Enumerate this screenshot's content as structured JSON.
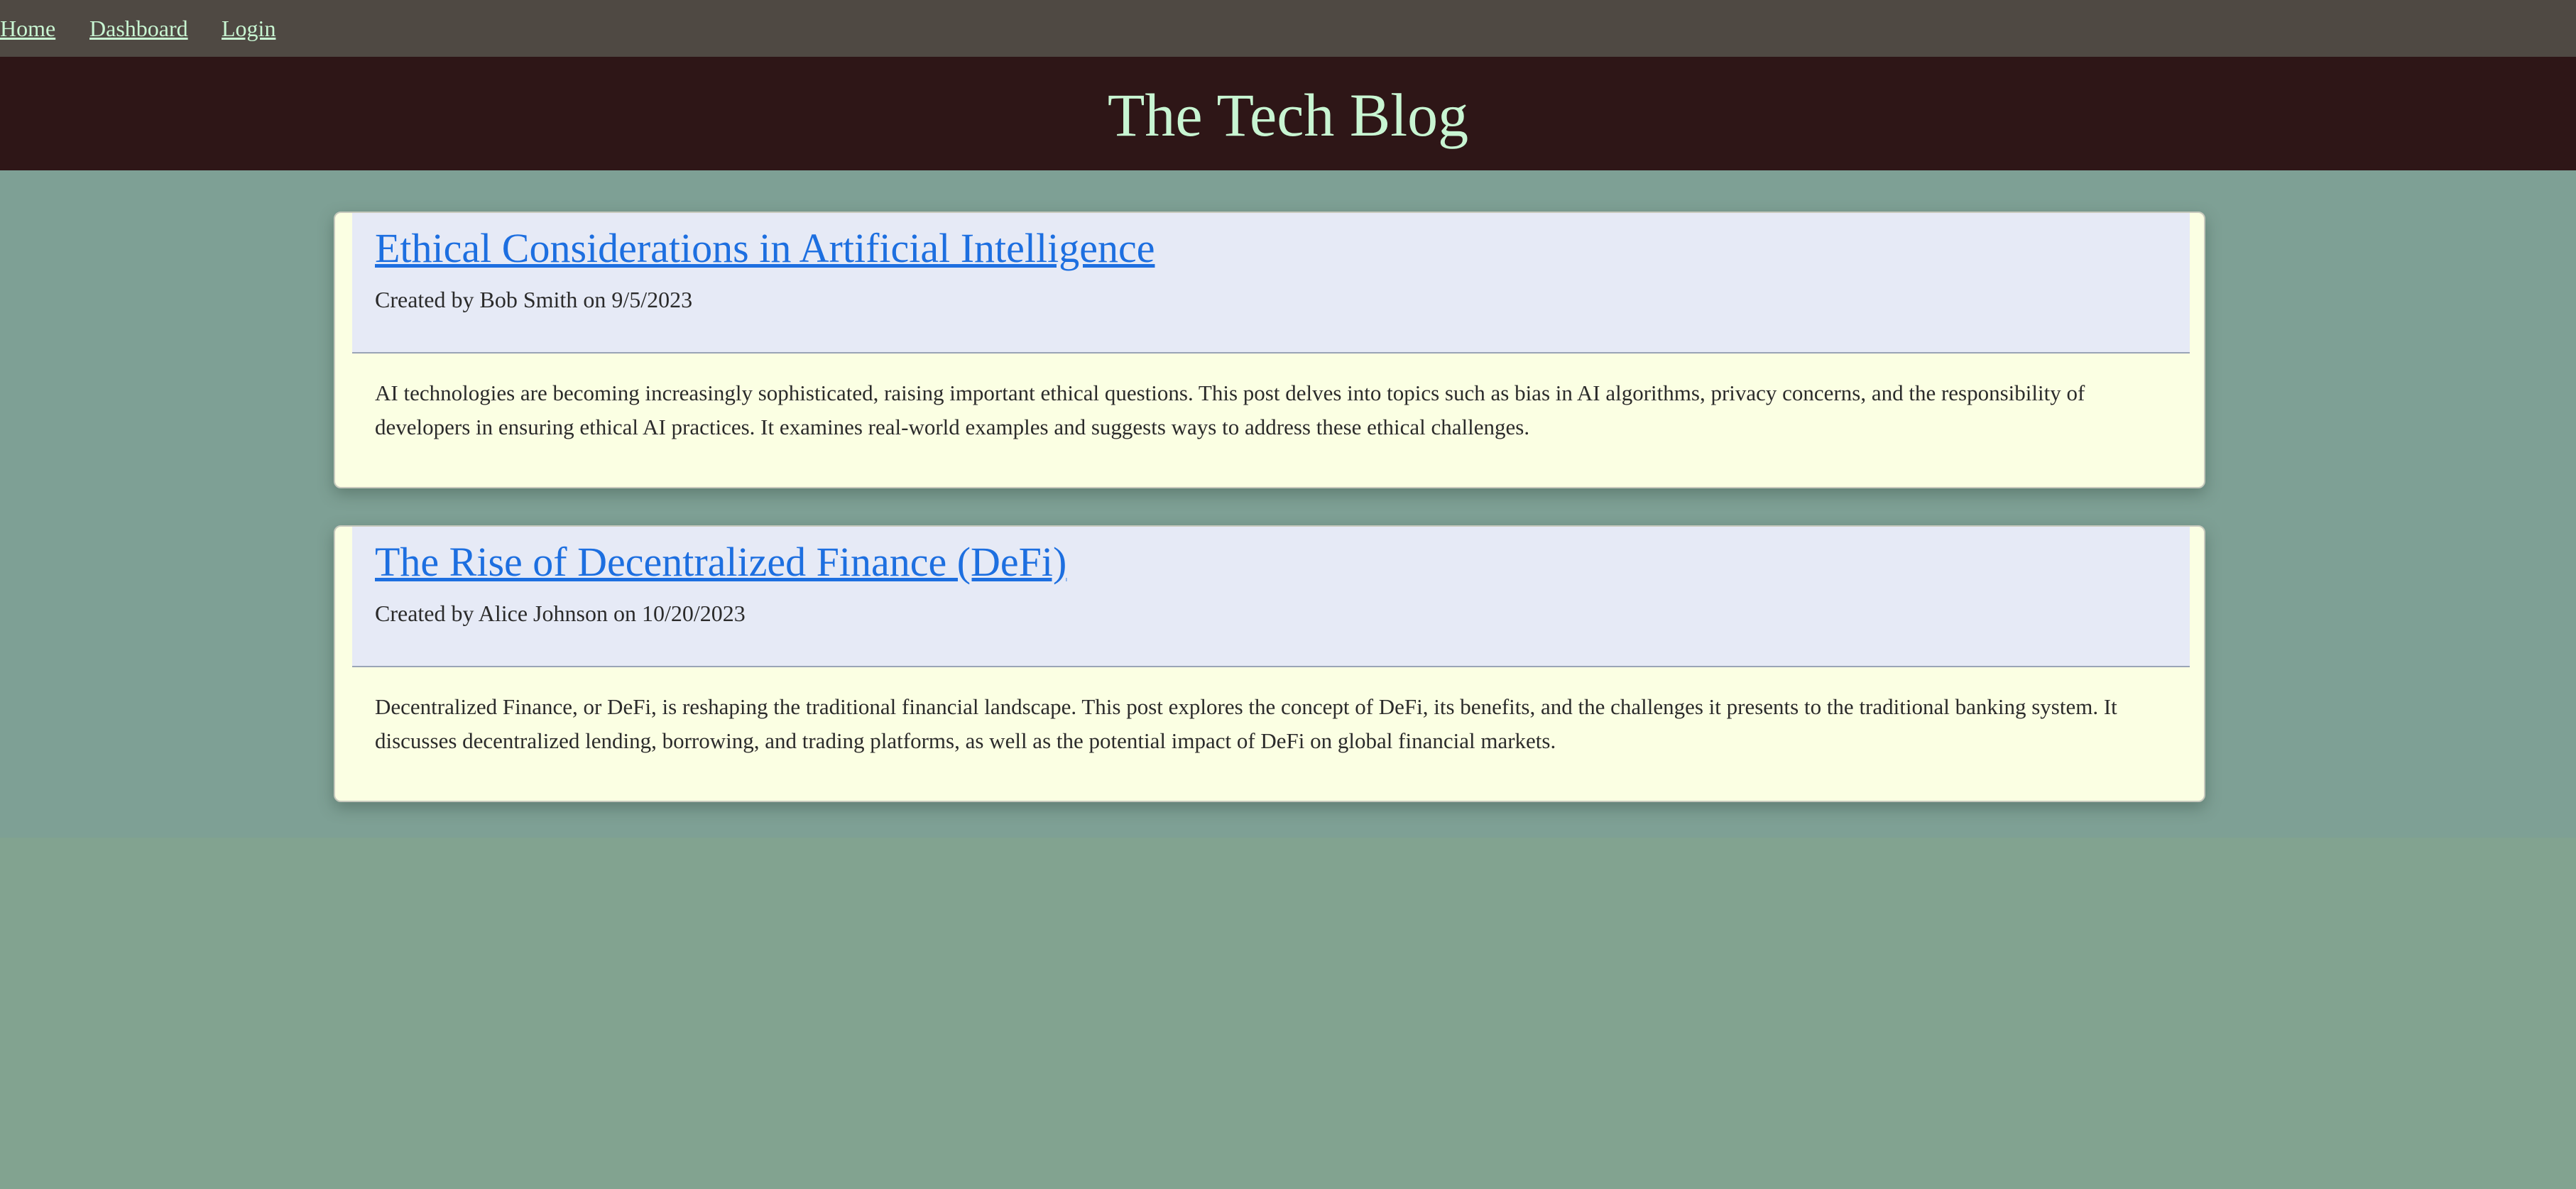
{
  "nav": {
    "home": "Home",
    "dashboard": "Dashboard",
    "login": "Login"
  },
  "site": {
    "title": "The Tech Blog"
  },
  "posts": [
    {
      "title": "Ethical Considerations in Artificial Intelligence",
      "meta": "Created by Bob Smith on 9/5/2023",
      "body": "AI technologies are becoming increasingly sophisticated, raising important ethical questions. This post delves into topics such as bias in AI algorithms, privacy concerns, and the responsibility of developers in ensuring ethical AI practices. It examines real-world examples and suggests ways to address these ethical challenges."
    },
    {
      "title": "The Rise of Decentralized Finance (DeFi)",
      "meta": "Created by Alice Johnson on 10/20/2023",
      "body": "Decentralized Finance, or DeFi, is reshaping the traditional financial landscape. This post explores the concept of DeFi, its benefits, and the challenges it presents to the traditional banking system. It discusses decentralized lending, borrowing, and trading platforms, as well as the potential impact of DeFi on global financial markets."
    }
  ],
  "colors": {
    "nav_bg": "#4f4943",
    "header_bg": "#2e1617",
    "page_bg": "#82a390",
    "accent_text": "#c8f5d2",
    "link": "#1d6fe0",
    "card_bg": "#fbffe3",
    "card_head_bg": "#e6eaf6"
  }
}
